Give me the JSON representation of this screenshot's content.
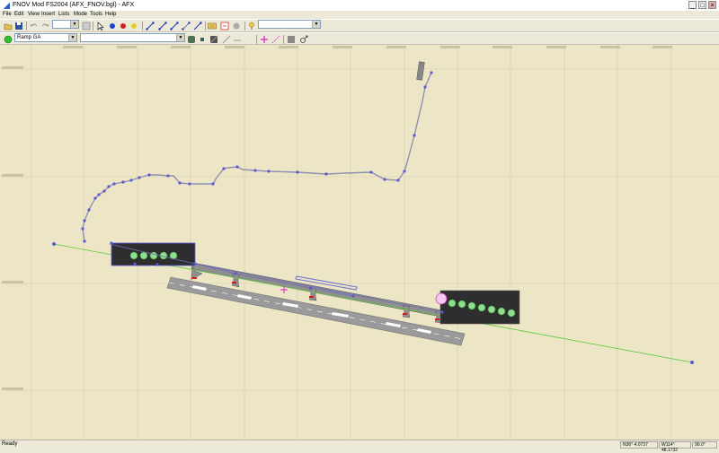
{
  "window": {
    "title": "FNOV Mod FS2004 (AFX_FNOV.bgl) - AFX",
    "minimize": "_",
    "maximize": "□",
    "close": "×"
  },
  "menu": [
    "File",
    "Edit",
    "View",
    "Insert",
    "Lists",
    "Mode",
    "Tools",
    "Help"
  ],
  "toolbar": {
    "object_selector": "",
    "layer_selector": "",
    "ramp_selector": "Ramp GA",
    "icons": [
      "open-icon",
      "save-icon",
      "undo-icon",
      "redo-icon",
      "select-icon",
      "blue-point-icon",
      "red-point-icon",
      "yellow-point-icon",
      "link-icon",
      "grid-icon",
      "pointer-icon"
    ]
  },
  "status": {
    "ready": "Ready",
    "latitude": "N36° 4.0737",
    "longitude": "W114° 48.1732",
    "zoom": "90.0°"
  },
  "colors": {
    "map_bg": "#ede6c6",
    "grid": "#c5c2a6",
    "taxi_path": "#9090b0",
    "taxi_node": "#5a5ad8",
    "apron": "#2c2c2c",
    "parking": "#8ce08c",
    "centerline": "#5ec840"
  }
}
